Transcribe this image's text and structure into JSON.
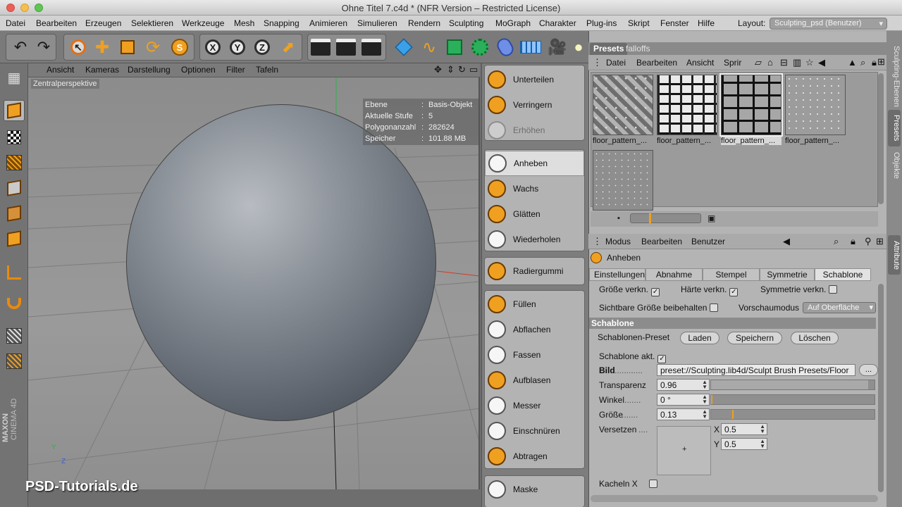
{
  "window": {
    "title": "Ohne Titel 7.c4d * (NFR Version – Restricted License)"
  },
  "menubar": {
    "items": [
      "Datei",
      "Bearbeiten",
      "Erzeugen",
      "Selektieren",
      "Werkzeuge",
      "Mesh",
      "Snapping",
      "Animieren",
      "Simulieren",
      "Rendern",
      "Sculpting",
      "MoGraph",
      "Charakter",
      "Plug-ins",
      "Skript",
      "Fenster",
      "Hilfe"
    ],
    "layout_label": "Layout:",
    "layout_value": "Sculpting_psd (Benutzer)"
  },
  "toolbar": {
    "icons": [
      "undo-icon",
      "redo-icon",
      "select-arrow-icon",
      "move-icon",
      "scale-icon",
      "rotate-icon",
      "sculpt-brush-icon",
      "x-axis-icon",
      "y-axis-icon",
      "z-axis-icon",
      "world-coordinates-icon",
      "render-view-icon",
      "render-picture-icon",
      "render-settings-icon",
      "cube-icon",
      "spline-icon",
      "nurbs-icon",
      "array-icon",
      "deformer-icon",
      "floor-icon",
      "camera-icon",
      "light-icon"
    ],
    "axis_labels": [
      "X",
      "Y",
      "Z"
    ]
  },
  "viewport": {
    "menu": [
      "Ansicht",
      "Kameras",
      "Darstellung",
      "Optionen",
      "Filter",
      "Tafeln"
    ],
    "label": "Zentralperspektive",
    "hud": [
      {
        "k": "Ebene",
        "v": "Basis-Objekt"
      },
      {
        "k": "Aktuelle Stufe",
        "v": "5"
      },
      {
        "k": "Polygonanzahl",
        "v": "282624"
      },
      {
        "k": "Speicher",
        "v": "101.88 MB"
      }
    ],
    "watermark": "PSD-Tutorials.de",
    "brand_1": "MAXON",
    "brand_2": "CINEMA 4D",
    "axis_y": "Y",
    "axis_z": "Z"
  },
  "brushes": {
    "group1": [
      "Unterteilen",
      "Verringern",
      "Erhöhen"
    ],
    "group2": [
      "Anheben",
      "Wachs",
      "Glätten",
      "Wiederholen"
    ],
    "group3": [
      "Radiergummi"
    ],
    "group4": [
      "Füllen",
      "Abflachen",
      "Fassen",
      "Aufblasen",
      "Messer",
      "Einschnüren",
      "Abtragen"
    ],
    "group5": [
      "Maske"
    ]
  },
  "presets": {
    "tabs": [
      "Presets",
      "falloffs"
    ],
    "menu": [
      "Datei",
      "Bearbeiten",
      "Ansicht",
      "Sprir"
    ],
    "thumbs": [
      "floor_pattern_...",
      "floor_pattern_...",
      "floor_pattern_...",
      "floor_pattern_...",
      ""
    ]
  },
  "sidetabs": [
    "Sculpting-Ebenen",
    "Presets",
    "Objekte",
    "Attribute"
  ],
  "attributes": {
    "menu": [
      "Modus",
      "Bearbeiten",
      "Benutzer"
    ],
    "tool_name": "Anheben",
    "tabs": [
      "Einstellungen",
      "Abnahme",
      "Stempel",
      "Symmetrie",
      "Schablone"
    ],
    "groesse_verkn": "Größe verkn.",
    "haerte_verkn": "Härte verkn.",
    "symmetrie_verkn": "Symmetrie verkn.",
    "sichtbare_groesse": "Sichtbare Größe beibehalten",
    "vorschaumodus": "Vorschaumodus",
    "vorschaumodus_value": "Auf Oberfläche",
    "section": "Schablone",
    "preset_label": "Schablonen-Preset",
    "btn_laden": "Laden",
    "btn_speichern": "Speichern",
    "btn_loeschen": "Löschen",
    "schablone_akt": "Schablone akt.",
    "bild_label": "Bild",
    "bild_value": "preset://Sculpting.lib4d/Sculpt Brush Presets/Floor",
    "bild_btn": "...",
    "transparenz_label": "Transparenz",
    "transparenz_value": "0.96",
    "winkel_label": "Winkel",
    "winkel_value": "0 °",
    "groesse_label": "Größe",
    "groesse_value": "0.13",
    "versetzen_label": "Versetzen",
    "x_label": "X",
    "x_value": "0.5",
    "y_label": "Y",
    "y_value": "0.5",
    "kacheln_label": "Kacheln X",
    "plus": "+",
    "check": "✓"
  },
  "levels": {
    "transparenz": 0.96,
    "winkel": 0.0,
    "groesse": 0.13
  },
  "colors": {
    "accent": "#f0a020",
    "sphere": "#6a717a"
  }
}
